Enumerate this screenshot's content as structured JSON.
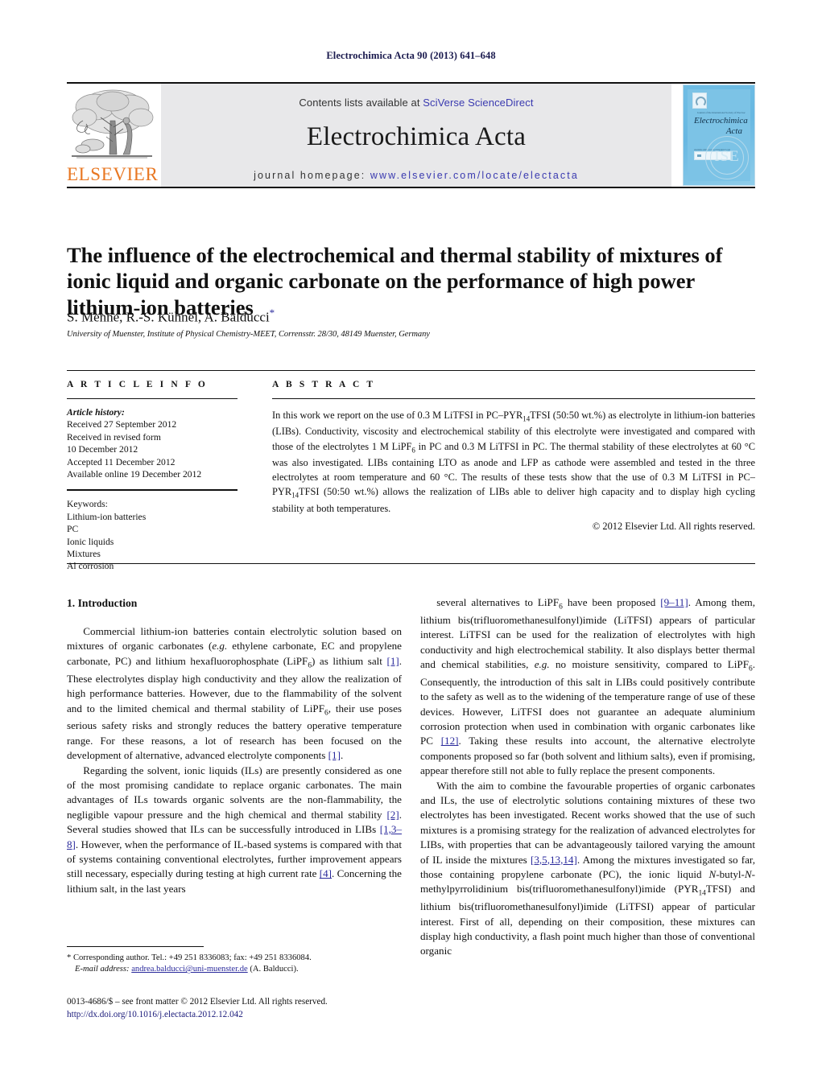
{
  "running_head": "Electrochimica Acta 90 (2013) 641–648",
  "masthead": {
    "contents_prefix": "Contents lists available at ",
    "contents_link": "SciVerse ScienceDirect",
    "journal_title": "Electrochimica Acta",
    "homepage_prefix": "journal homepage: ",
    "homepage_link": "www.elsevier.com/locate/electacta",
    "publisher_wordmark": "ELSEVIER",
    "publisher_color": "#E87722",
    "link_color": "#3a3ab0",
    "band_color": "#e8e8ea",
    "cover": {
      "journal_name_line1": "Electrochimica",
      "journal_name_line2": "Acta",
      "society_mark": "ISE",
      "masthead_micro": "Journal of the International Society of Electrochemistry",
      "footer_micro": "Available online at www.sciencedirect.com"
    }
  },
  "article": {
    "title": "The influence of the electrochemical and thermal stability of mixtures of ionic liquid and organic carbonate on the performance of high power lithium-ion batteries",
    "authors": "S. Menne, R.-S. Kühnel, A. Balducci",
    "corresponding_marker": "*",
    "affiliation": "University of Muenster, Institute of Physical Chemistry-MEET, Corrensstr. 28/30, 48149 Muenster, Germany"
  },
  "article_info": {
    "heading": "A R T I C L E    I N F O",
    "history_label": "Article history:",
    "history": [
      "Received 27 September 2012",
      "Received in revised form",
      "10 December 2012",
      "Accepted 11 December 2012",
      "Available online 19 December 2012"
    ],
    "keywords_label": "Keywords:",
    "keywords": [
      "Lithium-ion batteries",
      "PC",
      "Ionic liquids",
      "Mixtures",
      "Al corrosion"
    ]
  },
  "abstract": {
    "heading": "A B S T R A C T",
    "paragraph_part1": "In this work we report on the use of 0.3 M LiTFSI in PC–PYR",
    "sub1": "14",
    "paragraph_part2": "TFSI (50:50 wt.%) as electrolyte in lithium-ion batteries (LIBs). Conductivity, viscosity and electrochemical stability of this electrolyte were investigated and compared with those of the electrolytes 1 M LiPF",
    "sub2": "6",
    "paragraph_part3": " in PC and 0.3 M LiTFSI in PC. The thermal stability of these electrolytes at 60 °C was also investigated. LIBs containing LTO as anode and LFP as cathode were assembled and tested in the three electrolytes at room temperature and 60 °C. The results of these tests show that the use of 0.3 M LiTFSI in PC–PYR",
    "sub3": "14",
    "paragraph_part4": "TFSI (50:50 wt.%) allows the realization of LIBs able to deliver high capacity and to display high cycling stability at both temperatures.",
    "copyright": "© 2012 Elsevier Ltd. All rights reserved."
  },
  "body": {
    "section_heading": "1. Introduction",
    "left_column": {
      "p1_a": "Commercial lithium-ion batteries contain electrolytic solution based on mixtures of organic carbonates (",
      "p1_i1": "e.g.",
      "p1_b": " ethylene carbonate, EC and propylene carbonate, PC) and lithium hexafluorophosphate (LiPF",
      "p1_sub1": "6",
      "p1_c": ") as lithium salt ",
      "p1_ref1": "[1]",
      "p1_d": ". These electrolytes display high conductivity and they allow the realization of high performance batteries. However, due to the flammability of the solvent and to the limited chemical and thermal stability of LiPF",
      "p1_sub2": "6",
      "p1_e": ", their use poses serious safety risks and strongly reduces the battery operative temperature range. For these reasons, a lot of research has been focused on the development of alternative, advanced electrolyte components ",
      "p1_ref2": "[1]",
      "p1_f": ".",
      "p2_a": "Regarding the solvent, ionic liquids (ILs) are presently considered as one of the most promising candidate to replace organic carbonates. The main advantages of ILs towards organic solvents are the non-flammability, the negligible vapour pressure and the high chemical and thermal stability ",
      "p2_ref1": "[2]",
      "p2_b": ". Several studies showed that ILs can be successfully introduced in LIBs ",
      "p2_ref2": "[1,3–8]",
      "p2_c": ". However, when the performance of IL-based systems is compared with that of systems containing conventional electrolytes, further improvement appears still necessary, especially during testing at high current rate ",
      "p2_ref3": "[4]",
      "p2_d": ". Concerning the lithium salt, in the last years"
    },
    "right_column": {
      "p1_a": "several alternatives to LiPF",
      "p1_sub1": "6",
      "p1_b": " have been proposed ",
      "p1_ref1": "[9–11]",
      "p1_c": ". Among them, lithium bis(trifluoromethanesulfonyl)imide (LiTFSI) appears of particular interest. LiTFSI can be used for the realization of electrolytes with high conductivity and high electrochemical stability. It also displays better thermal and chemical stabilities, ",
      "p1_i1": "e.g.",
      "p1_d": " no moisture sensitivity, compared to LiPF",
      "p1_sub2": "6",
      "p1_e": ". Consequently, the introduction of this salt in LIBs could positively contribute to the safety as well as to the widening of the temperature range of use of these devices. However, LiTFSI does not guarantee an adequate aluminium corrosion protection when used in combination with organic carbonates like PC ",
      "p1_ref2": "[12]",
      "p1_f": ". Taking these results into account, the alternative electrolyte components proposed so far (both solvent and lithium salts), even if promising, appear therefore still not able to fully replace the present components.",
      "p2_a": "With the aim to combine the favourable properties of organic carbonates and ILs, the use of electrolytic solutions containing mixtures of these two electrolytes has been investigated. Recent works showed that the use of such mixtures is a promising strategy for the realization of advanced electrolytes for LIBs, with properties that can be advantageously tailored varying the amount of IL inside the mixtures ",
      "p2_ref1": "[3,5,13,14]",
      "p2_b": ". Among the mixtures investigated so far, those containing propylene carbonate (PC), the ionic liquid ",
      "p2_i1": "N",
      "p2_c": "-butyl-",
      "p2_i2": "N",
      "p2_d": "-methylpyrrolidinium bis(trifluoromethanesulfonyl)imide (PYR",
      "p2_sub1": "14",
      "p2_e": "TFSI) and lithium bis(trifluoromethanesulfonyl)imide (LiTFSI) appear of particular interest. First of all, depending on their composition, these mixtures can display high conductivity, a flash point much higher than those of conventional organic"
    }
  },
  "footnotes": {
    "corresponding_marker": "*",
    "corresponding_text": " Corresponding author. Tel.: +49 251 8336083; fax: +49 251 8336084.",
    "email_label": "E-mail address:",
    "email": "andrea.balducci@uni-muenster.de",
    "email_suffix": " (A. Balducci).",
    "issn_line": "0013-4686/$ – see front matter © 2012 Elsevier Ltd. All rights reserved.",
    "doi": "http://dx.doi.org/10.1016/j.electacta.2012.12.042"
  }
}
